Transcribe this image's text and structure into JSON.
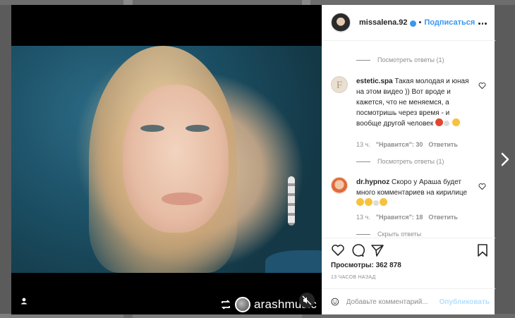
{
  "post": {
    "username": "missalena.92",
    "separator": "•",
    "follow_label": "Подписаться",
    "watermark_user": "arashmusic"
  },
  "comments": {
    "view_replies_1": "Посмотреть ответы (1)",
    "items": [
      {
        "user": "estetic.spa",
        "avatar_letter": "F",
        "text": "Такая молодая и юная на этом видео )) Вот вроде и кажется, что не меняемся, а посмотришь через время - и вообще другой человек",
        "time": "13 ч.",
        "likes": "\"Нравится\": 30",
        "reply": "Ответить",
        "replies_toggle": "Посмотреть ответы (1)"
      },
      {
        "user": "dr.hypnoz",
        "text": "Скоро у Араша будет много комментариев на кирилице",
        "time": "13 ч.",
        "likes": "\"Нравится\": 18",
        "reply": "Ответить",
        "replies_toggle": "Скрыть ответы"
      }
    ]
  },
  "stats": {
    "views_label": "Просмотры:",
    "views_count": "362 878",
    "time_ago": "13 ЧАСОВ НАЗАД"
  },
  "add_comment": {
    "placeholder": "Добавьте комментарий...",
    "publish_label": "Опубликовать"
  },
  "icons": {
    "like": "heart-icon",
    "comment": "comment-icon",
    "share": "share-icon",
    "save": "bookmark-icon",
    "emoji": "smiley-icon",
    "more": "more-dots-icon",
    "mute": "speaker-muted-icon",
    "tag": "user-tag-icon",
    "repost": "repost-icon",
    "next": "chevron-right-icon"
  },
  "colors": {
    "accent": "#3897f0",
    "publish_disabled": "#b2dffc",
    "text": "#262626",
    "muted": "#8e8e8e"
  }
}
